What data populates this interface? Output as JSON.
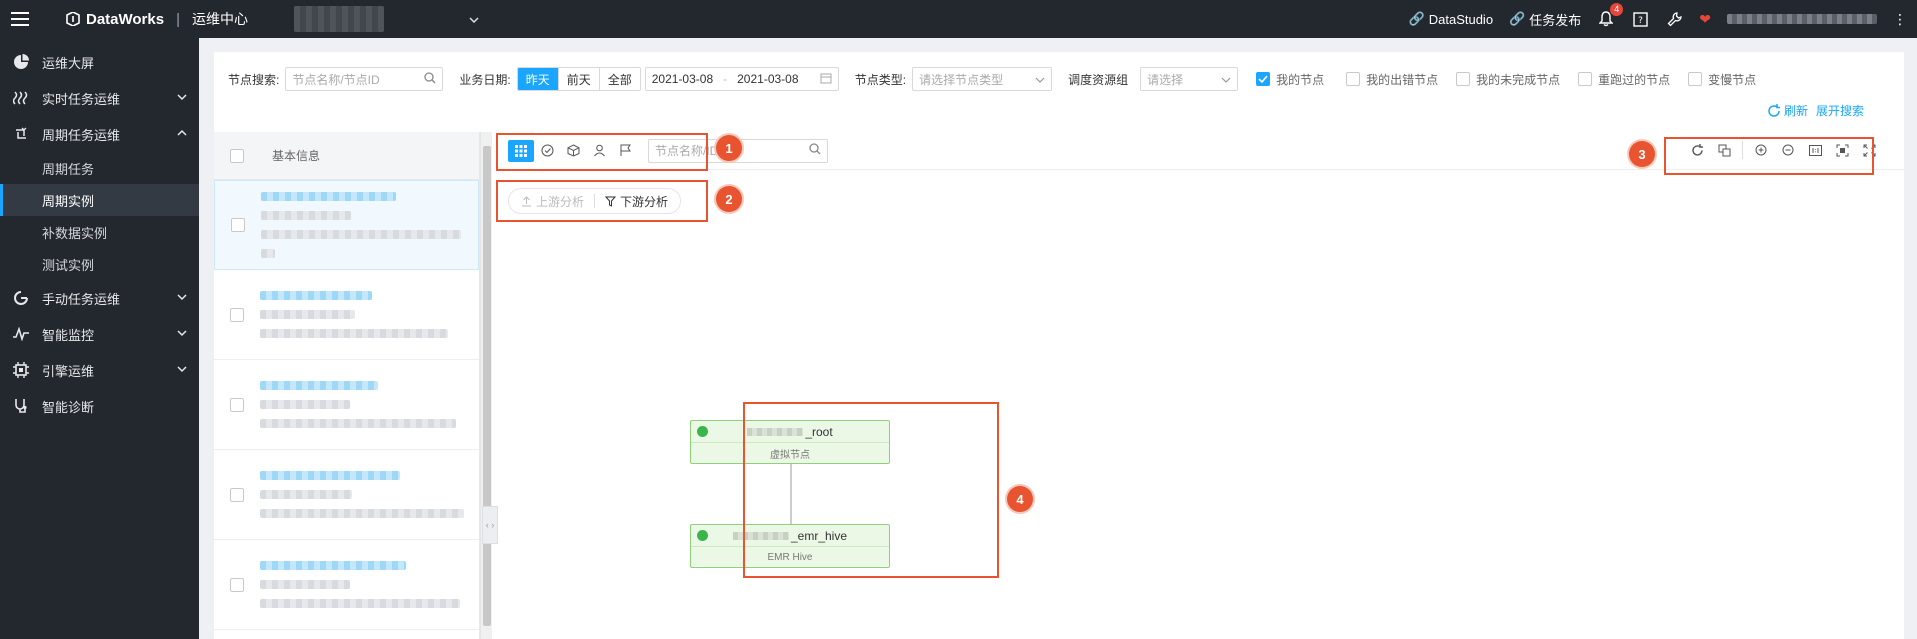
{
  "topbar": {
    "brand": "DataWorks",
    "module": "运维中心",
    "links": {
      "datastudio": "DataStudio",
      "publish": "任务发布"
    },
    "notification_count": "4"
  },
  "sidebar": {
    "items": [
      {
        "label": "运维大屏",
        "icon": "dashboard-icon"
      },
      {
        "label": "实时任务运维",
        "icon": "realtime-icon"
      },
      {
        "label": "周期任务运维",
        "icon": "cycle-icon"
      },
      {
        "label": "手动任务运维",
        "icon": "manual-icon"
      },
      {
        "label": "智能监控",
        "icon": "monitor-icon"
      },
      {
        "label": "引擎运维",
        "icon": "engine-icon"
      },
      {
        "label": "智能诊断",
        "icon": "diagnosis-icon"
      }
    ],
    "sub_items": [
      "周期任务",
      "周期实例",
      "补数据实例",
      "测试实例"
    ]
  },
  "filters": {
    "node_search_label": "节点搜索:",
    "node_search_placeholder": "节点名称/节点ID",
    "biz_date_label": "业务日期:",
    "date_options": [
      "昨天",
      "前天",
      "全部"
    ],
    "date_start": "2021-03-08",
    "date_sep": "-",
    "date_end": "2021-03-08",
    "node_type_label": "节点类型:",
    "node_type_placeholder": "请选择节点类型",
    "resource_group_label": "调度资源组",
    "resource_group_placeholder": "请选择",
    "checks": [
      {
        "label": "我的节点",
        "checked": true
      },
      {
        "label": "我的出错节点",
        "checked": false
      },
      {
        "label": "我的未完成节点",
        "checked": false
      },
      {
        "label": "重跑过的节点",
        "checked": false
      },
      {
        "label": "变慢节点",
        "checked": false
      }
    ],
    "refresh": "刷新",
    "expand": "展开搜索"
  },
  "list": {
    "header": "基本信息"
  },
  "canvas": {
    "search_placeholder": "节点名称/ID",
    "upstream": "上游分析",
    "downstream": "下游分析",
    "nodes": [
      {
        "name_suffix": "_root",
        "type": "虚拟节点"
      },
      {
        "name_suffix": "_emr_hive",
        "type": "EMR Hive"
      }
    ]
  },
  "callouts": [
    "1",
    "2",
    "3",
    "4"
  ],
  "colors": {
    "accent": "#1aa5ff",
    "callout": "#e8542f",
    "success": "#39b54a"
  }
}
